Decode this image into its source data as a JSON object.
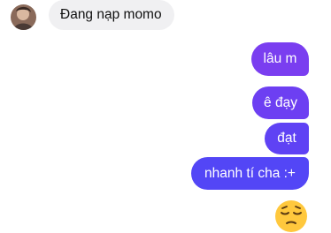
{
  "conversation": {
    "incoming": [
      {
        "text": "Đang nạp momo"
      }
    ],
    "outgoing": [
      {
        "text": "lâu m"
      },
      {
        "text": "ê đạy"
      },
      {
        "text": "đạt"
      },
      {
        "text": "nhanh tí cha :+"
      }
    ],
    "reaction_emoji": "pensive-face"
  },
  "colors": {
    "incoming_bubble": "#f0f0f2",
    "outgoing_gradient": [
      "#7a3ef0",
      "#6d3ff2",
      "#5f42f4",
      "#5346f6"
    ],
    "emoji_yellow": "#ffc83d"
  }
}
